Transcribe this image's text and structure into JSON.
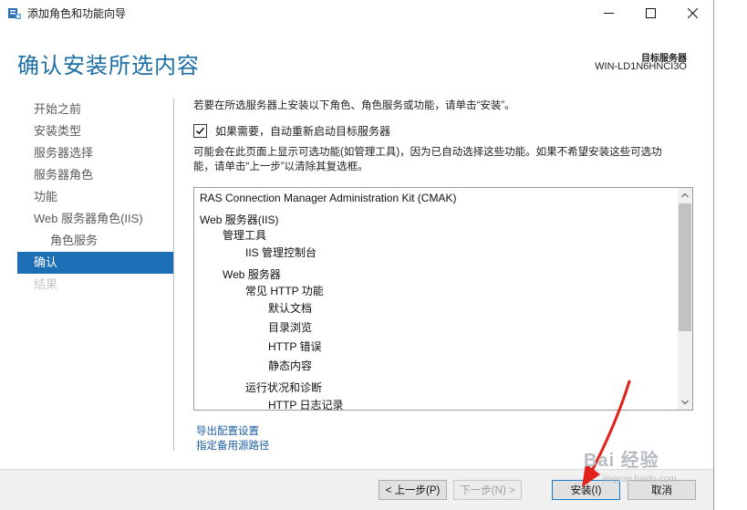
{
  "window": {
    "title": "添加角色和功能向导"
  },
  "header": {
    "page_title": "确认安装所选内容",
    "destination_label": "目标服务器",
    "destination_server": "WIN-LD1N6HNCI3O"
  },
  "nav": {
    "items": [
      {
        "label": "开始之前"
      },
      {
        "label": "安装类型"
      },
      {
        "label": "服务器选择"
      },
      {
        "label": "服务器角色"
      },
      {
        "label": "功能"
      },
      {
        "label": "Web 服务器角色(IIS)"
      },
      {
        "label": "角色服务"
      },
      {
        "label": "确认"
      },
      {
        "label": "结果"
      }
    ],
    "active_index": 7
  },
  "content": {
    "intro": "若要在所选服务器上安装以下角色、角色服务或功能，请单击“安装”。",
    "restart_checkbox": {
      "label": "如果需要，自动重新启动目标服务器",
      "checked": true
    },
    "note_line1": "可能会在此页面上显示可选功能(如管理工具)，因为已自动选择这些功能。如果不希望安装这些可选功",
    "note_line2": "能，请单击“上一步”以清除其复选框。",
    "list_items": [
      {
        "text": "RAS Connection Manager Administration Kit (CMAK)",
        "level": 0
      },
      {
        "text": "Web 服务器(IIS)",
        "level": 0
      },
      {
        "text": "管理工具",
        "level": 1
      },
      {
        "text": "IIS 管理控制台",
        "level": 2
      },
      {
        "text": "Web 服务器",
        "level": 1
      },
      {
        "text": "常见 HTTP 功能",
        "level": 2
      },
      {
        "text": "默认文档",
        "level": 3
      },
      {
        "text": "目录浏览",
        "level": 3
      },
      {
        "text": "HTTP 错误",
        "level": 3
      },
      {
        "text": "静态内容",
        "level": 3
      },
      {
        "text": "运行状况和诊断",
        "level": 2
      },
      {
        "text": "HTTP 日志记录",
        "level": 3
      }
    ],
    "links": {
      "export": "导出配置设置",
      "alternate_source": "指定备用源路径"
    }
  },
  "buttons": {
    "previous": "< 上一步(P)",
    "next": "下一步(N) >",
    "install": "安装(I)",
    "cancel": "取消"
  },
  "watermark": {
    "text": "Bai 经验",
    "sub": "jingyan.baidu.com"
  },
  "colors": {
    "accent": "#1d6fb5",
    "title": "#1c6ea4",
    "link": "#1d5fa0",
    "annotation_arrow": "#e0221a"
  }
}
